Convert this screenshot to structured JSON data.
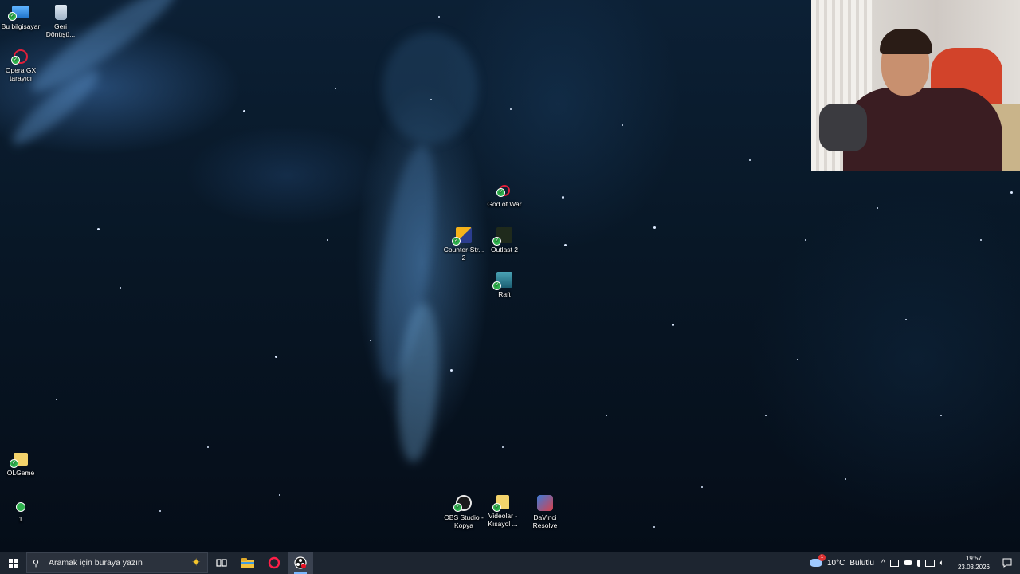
{
  "desktop_icons": {
    "this_pc": "Bu bilgisayar",
    "recycle_bin": "Geri Dönüşü...",
    "opera_gx_l1": "Opera GX",
    "opera_gx_l2": "tarayıcı",
    "god_of_war": "God of War",
    "counter_strike_l1": "Counter-Str...",
    "counter_strike_l2": "2",
    "outlast": "Outlast 2",
    "raft": "Raft",
    "olgame": "OLGame",
    "one": "1",
    "obs_l1": "OBS Studio -",
    "obs_l2": "Kopya",
    "videolar_l1": "Videolar -",
    "videolar_l2": "Kısayol ...",
    "davinci_l1": "DaVinci",
    "davinci_l2": "Resolve"
  },
  "taskbar": {
    "search_placeholder": "Aramak için buraya yazın",
    "weather_temp": "10°C",
    "weather_desc": "Bulutlu",
    "weather_badge": "1",
    "time": "19:57",
    "date": "23.03.2026"
  },
  "icons": {
    "start": "windows-logo",
    "search": "search-icon",
    "taskview": "task-view-icon",
    "explorer": "folder-icon",
    "opera": "opera-gx-icon",
    "obs": "obs-icon"
  }
}
